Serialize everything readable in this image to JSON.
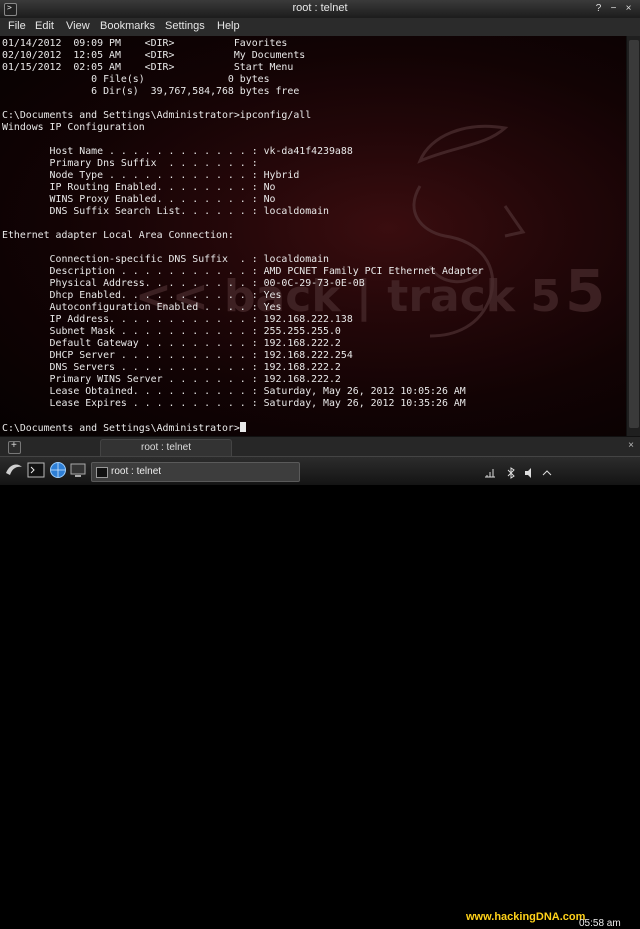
{
  "window": {
    "title": "root : telnet"
  },
  "menu": [
    "File",
    "Edit",
    "View",
    "Bookmarks",
    "Settings",
    "Help"
  ],
  "terminal": {
    "lines": [
      "01/14/2012  09:09 PM    <DIR>          Favorites",
      "02/10/2012  12:05 AM    <DIR>          My Documents",
      "01/15/2012  02:05 AM    <DIR>          Start Menu",
      "               0 File(s)              0 bytes",
      "               6 Dir(s)  39,767,584,768 bytes free",
      "",
      "C:\\Documents and Settings\\Administrator>ipconfig/all",
      "Windows IP Configuration",
      "",
      "        Host Name . . . . . . . . . . . . : vk-da41f4239a88",
      "        Primary Dns Suffix  . . . . . . . :",
      "        Node Type . . . . . . . . . . . . : Hybrid",
      "        IP Routing Enabled. . . . . . . . : No",
      "        WINS Proxy Enabled. . . . . . . . : No",
      "        DNS Suffix Search List. . . . . . : localdomain",
      "",
      "Ethernet adapter Local Area Connection:",
      "",
      "        Connection-specific DNS Suffix  . : localdomain",
      "        Description . . . . . . . . . . . : AMD PCNET Family PCI Ethernet Adapter",
      "        Physical Address. . . . . . . . . : 00-0C-29-73-0E-0B",
      "        Dhcp Enabled. . . . . . . . . . . : Yes",
      "        Autoconfiguration Enabled . . . . : Yes",
      "        IP Address. . . . . . . . . . . . : 192.168.222.138",
      "        Subnet Mask . . . . . . . . . . . : 255.255.255.0",
      "        Default Gateway . . . . . . . . . : 192.168.222.2",
      "        DHCP Server . . . . . . . . . . . : 192.168.222.254",
      "        DNS Servers . . . . . . . . . . . : 192.168.222.2",
      "        Primary WINS Server . . . . . . . : 192.168.222.2",
      "        Lease Obtained. . . . . . . . . . : Saturday, May 26, 2012 10:05:26 AM",
      "        Lease Expires . . . . . . . . . . : Saturday, May 26, 2012 10:35:26 AM",
      "",
      "C:\\Documents and Settings\\Administrator>"
    ],
    "watermark": "<< back | track 5"
  },
  "tabbar": {
    "tab_label": "root : telnet"
  },
  "taskbar": {
    "task_label": "root : telnet",
    "website": "www.hackingDNA.com",
    "clock": "05:58 am"
  },
  "colors": {
    "background_red": "#240709",
    "website_yellow": "#ffd21a",
    "text": "#e9e9e9"
  }
}
